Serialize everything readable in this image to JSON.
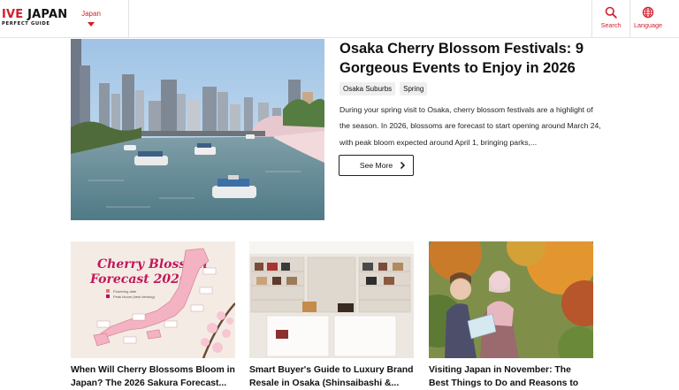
{
  "header": {
    "logo_line1_red": "IVE",
    "logo_line1": " JAPAN",
    "logo_line2": "PERFECT GUIDE",
    "area_label": "Japan",
    "search_label": "Search",
    "language_label": "Language"
  },
  "colors": {
    "accent": "#d21e2b",
    "tag_bg": "#efefef"
  },
  "featured": {
    "title": "Osaka Cherry Blossom Festivals: 9 Gorgeous Events to Enjoy in 2026",
    "tags": [
      "Osaka Suburbs",
      "Spring"
    ],
    "excerpt": "During your spring visit to Osaka, cherry blossom festivals are a highlight of the season. In 2026, blossoms are forecast to start opening around March 24, with peak bloom expected around April 1, bringing parks,...",
    "button_label": "See More"
  },
  "forecast_image": {
    "title_line1": "Cherry Blossom",
    "title_line2": "Forecast 2026",
    "legend_flowering": "Flowering date",
    "legend_peak": "Peak bloom (best viewing)"
  },
  "cards": [
    {
      "title": "When Will Cherry Blossoms Bloom in Japan? The 2026 Sakura Forecast..."
    },
    {
      "title": "Smart Buyer's Guide to Luxury Brand Resale in Osaka (Shinsaibashi &..."
    },
    {
      "title": "Visiting Japan in November: The Best Things to Do and Reasons to Visit"
    }
  ]
}
